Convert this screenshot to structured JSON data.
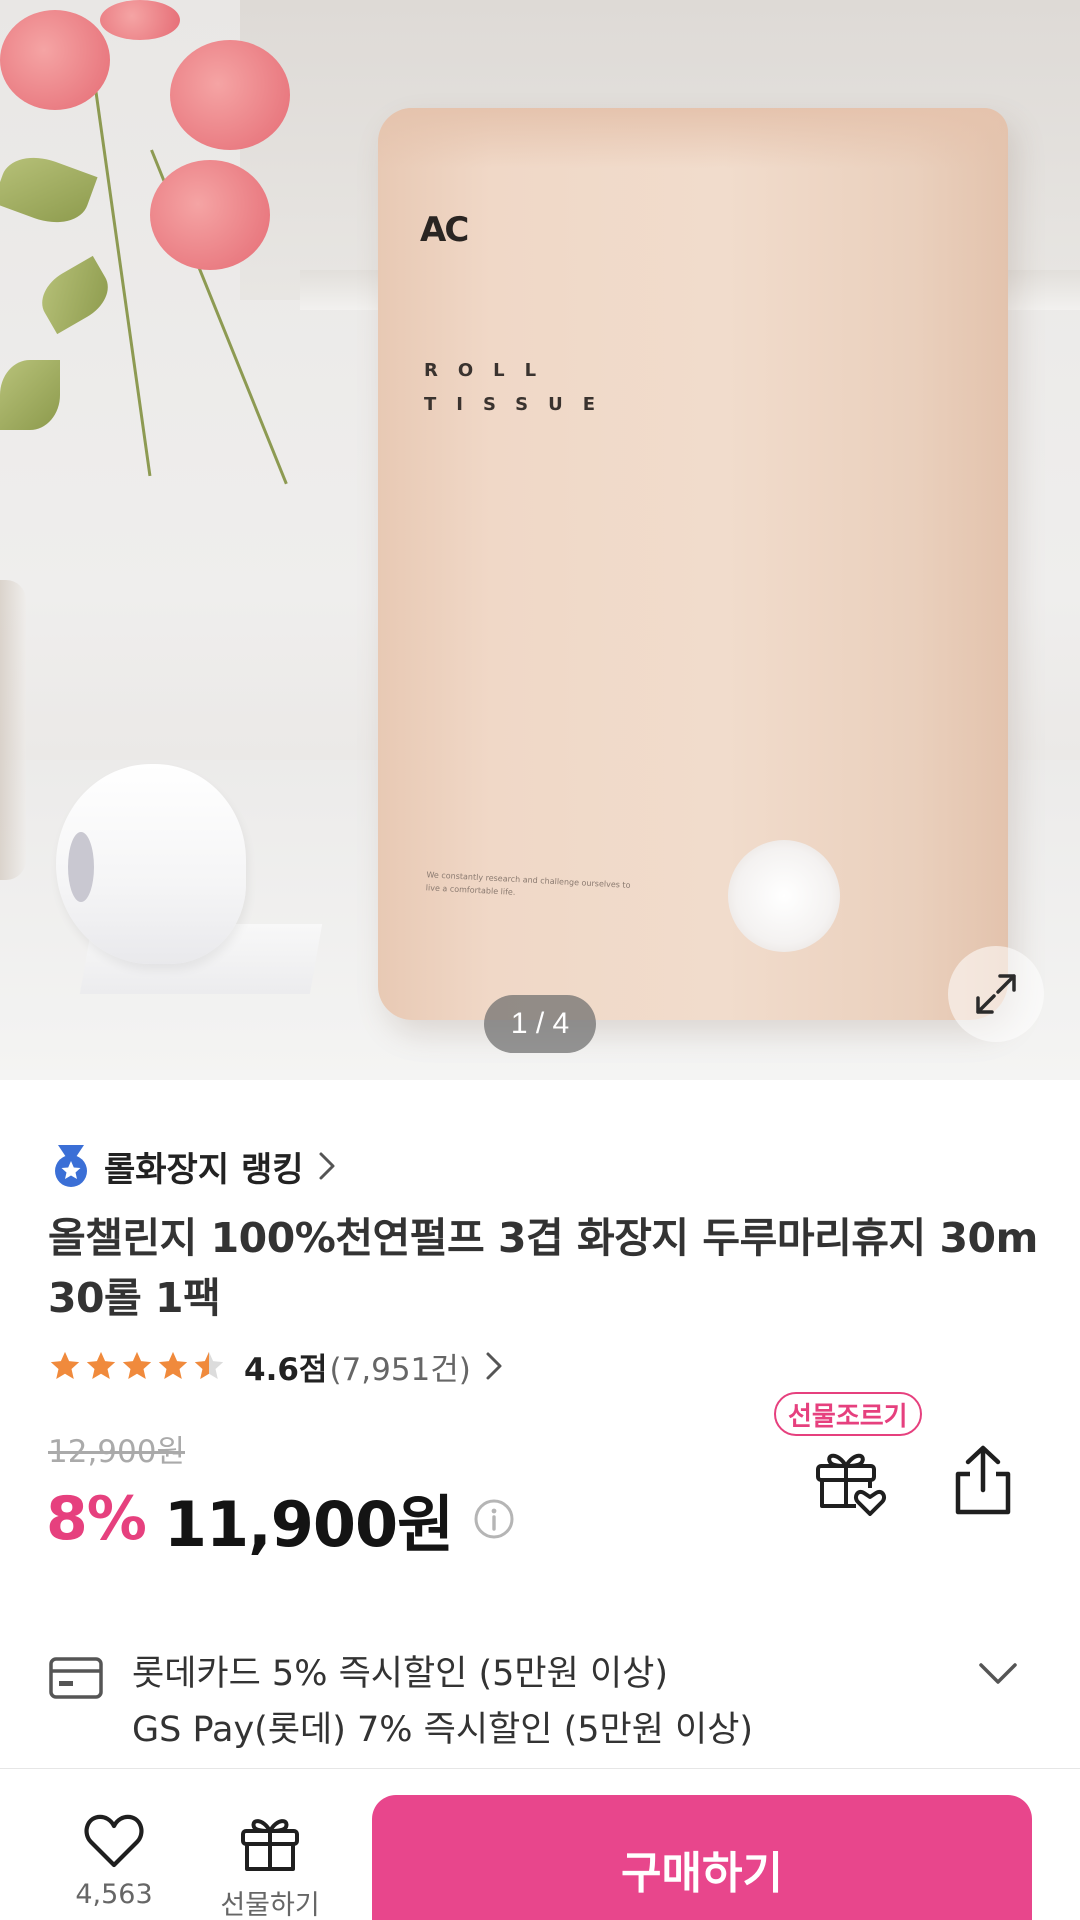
{
  "hero": {
    "counter": "1 / 4",
    "pack_logo": "AC",
    "pack_line1": "ROLL",
    "pack_line2": "TISSUE",
    "pack_tagline": "We constantly research and challenge ourselves to live a comfortable life.",
    "zoom_icon": "expand-arrows-icon"
  },
  "ranking": {
    "label": "롤화장지 랭킹",
    "icon": "medal-icon"
  },
  "product": {
    "title": "올챌린지 100%천연펄프 3겹 화장지 두루마리휴지 30m 30롤 1팩",
    "rating_score": "4.6점",
    "rating_count": "(7,951건)",
    "rating_value": 4.6,
    "original_price": "12,900원",
    "discount_rate": "8%",
    "sale_price": "11,900원"
  },
  "actions": {
    "gift_tag": "선물조르기",
    "gift_icon": "gift-heart-icon",
    "share_icon": "share-icon"
  },
  "benefits": [
    "롯데카드 5% 즉시할인 (5만원 이상)",
    "GS Pay(롯데) 7% 즉시할인 (5만원 이상)"
  ],
  "bottom_bar": {
    "like_count": "4,563",
    "gift_label": "선물하기",
    "buy_label": "구매하기"
  },
  "colors": {
    "accent": "#e6407e",
    "buy_button": "#e8468c",
    "star": "#f08a3c"
  }
}
